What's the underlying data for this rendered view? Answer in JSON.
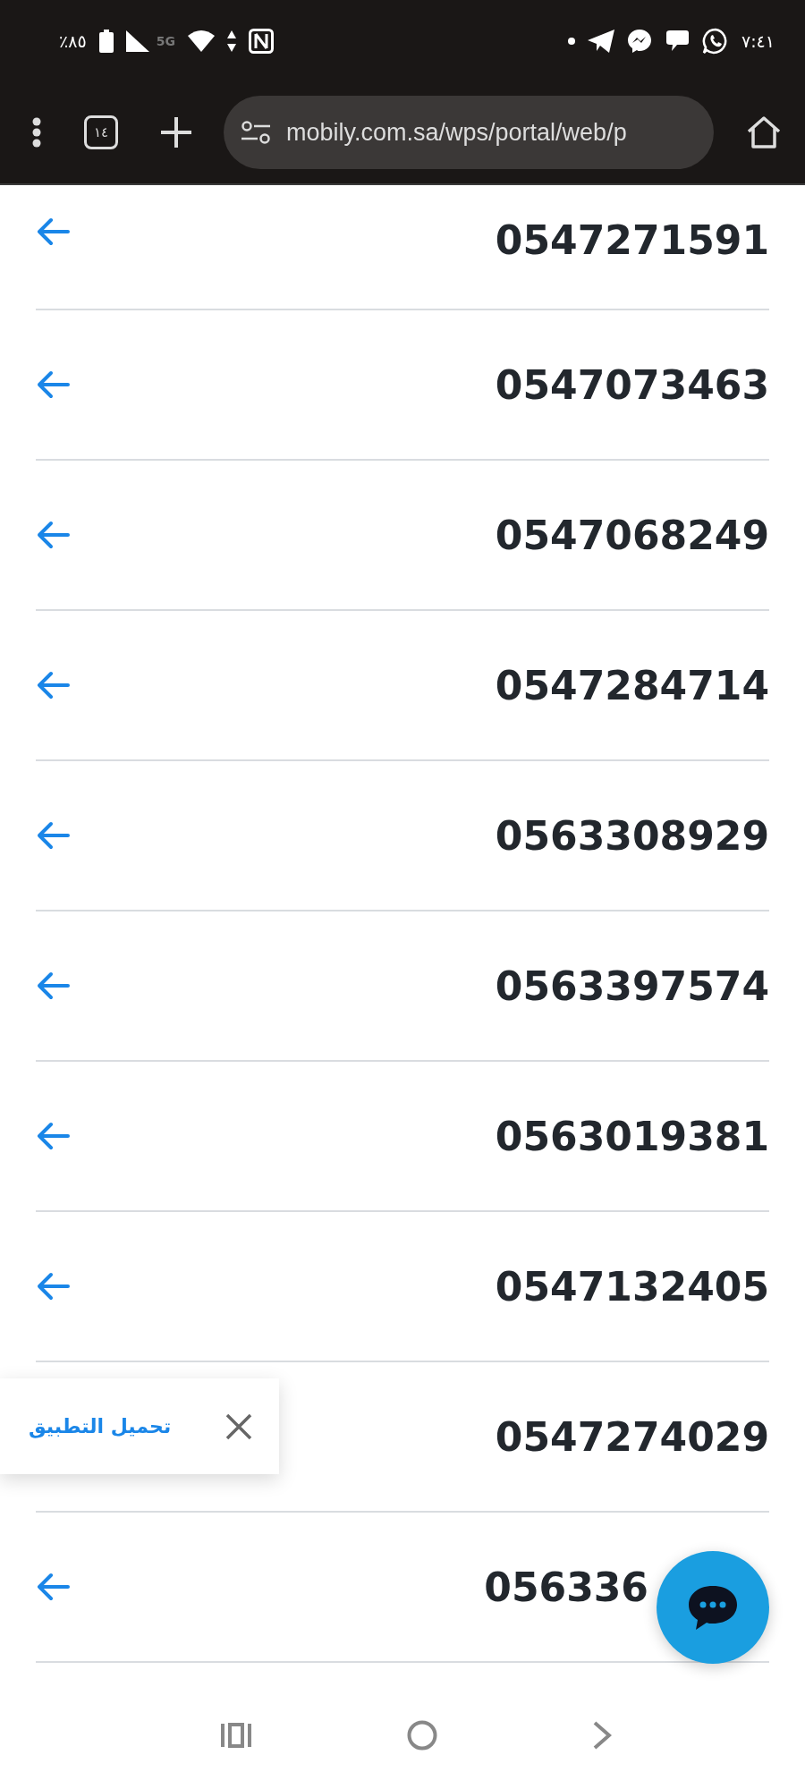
{
  "status_bar": {
    "battery": "٪٨٥",
    "network": "5G",
    "time": "٧:٤١"
  },
  "browser_toolbar": {
    "tab_count": "١٤",
    "url": "mobily.com.sa/wps/portal/web/p"
  },
  "numbers": [
    {
      "number": "0547271591"
    },
    {
      "number": "0547073463"
    },
    {
      "number": "0547068249"
    },
    {
      "number": "0547284714"
    },
    {
      "number": "0563308929"
    },
    {
      "number": "0563397574"
    },
    {
      "number": "0563019381"
    },
    {
      "number": "0547132405"
    },
    {
      "number": "0547274029"
    },
    {
      "number": "056336"
    }
  ],
  "app_banner": {
    "label": "تحميل التطبيق"
  }
}
